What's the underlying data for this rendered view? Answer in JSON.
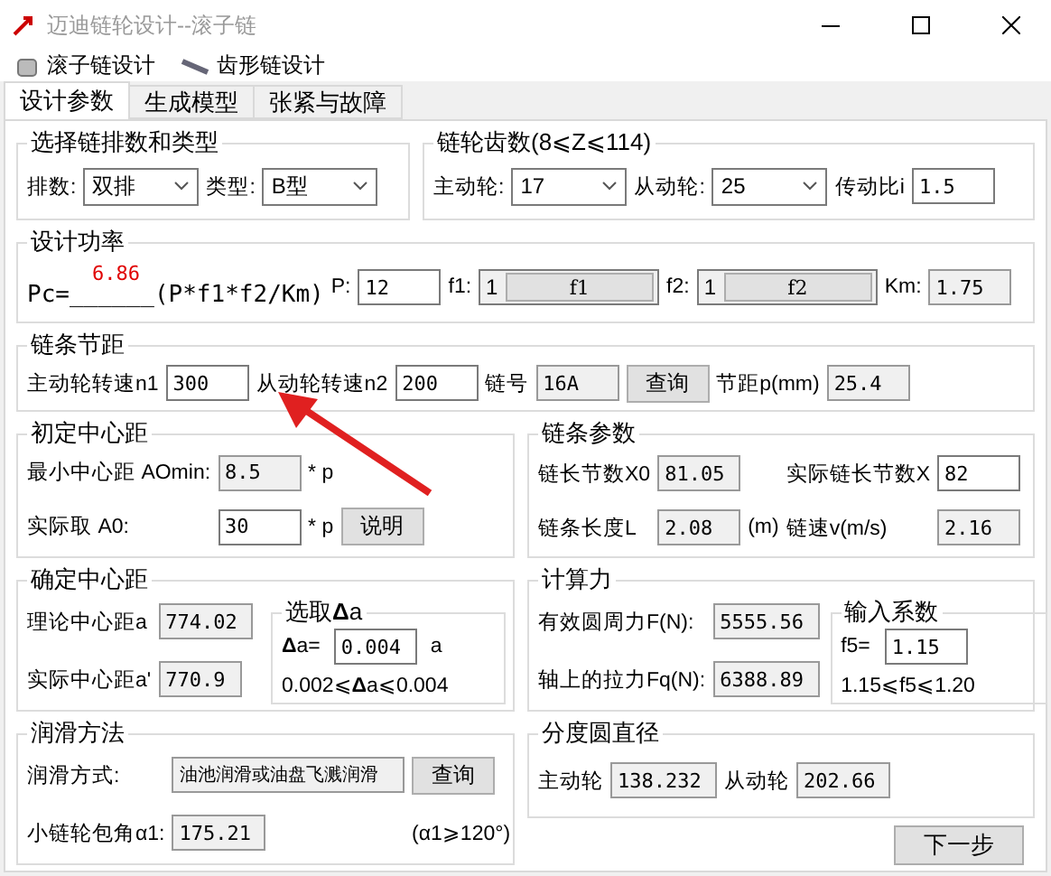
{
  "window": {
    "title": "迈迪链轮设计--滚子链"
  },
  "menu": [
    {
      "label": "滚子链设计"
    },
    {
      "label": "齿形链设计"
    }
  ],
  "tabs": [
    {
      "label": "设计参数",
      "selected": true
    },
    {
      "label": "生成模型",
      "selected": false
    },
    {
      "label": "张紧与故障",
      "selected": false
    }
  ],
  "groups": [
    {
      "title": "选择链排数和类型",
      "rows": [
        [
          {
            "kind": "label",
            "text": "排数:"
          },
          {
            "kind": "select",
            "value": "双排"
          },
          {
            "kind": "label",
            "text": "类型:"
          },
          {
            "kind": "select",
            "value": "B型"
          }
        ]
      ]
    },
    {
      "title": "链轮齿数(8⩽Z⩽114)",
      "rows": [
        [
          {
            "kind": "label",
            "text": "主动轮:"
          },
          {
            "kind": "select",
            "value": "17"
          },
          {
            "kind": "label",
            "text": "从动轮:"
          },
          {
            "kind": "select",
            "value": "25"
          },
          {
            "kind": "label",
            "text": "传动比i"
          },
          {
            "kind": "input",
            "value": "1.5"
          }
        ]
      ]
    },
    {
      "title": "设计功率",
      "rows": [
        [
          {
            "kind": "formula",
            "prefix": "Pc=",
            "result": "6.86",
            "blank": "______",
            "suffix": "(P*f1*f2/Km)"
          },
          {
            "kind": "label",
            "text": "P:"
          },
          {
            "kind": "input",
            "value": "12"
          },
          {
            "kind": "label",
            "text": "f1:"
          },
          {
            "kind": "factor",
            "value": "1",
            "button": "f1"
          },
          {
            "kind": "label",
            "text": "f2:"
          },
          {
            "kind": "factor",
            "value": "1",
            "button": "f2"
          },
          {
            "kind": "label",
            "text": "Km:"
          },
          {
            "kind": "readonly",
            "value": "1.75"
          }
        ]
      ]
    },
    {
      "title": "链条节距",
      "rows": [
        [
          {
            "kind": "label",
            "text": "主动轮转速n1"
          },
          {
            "kind": "input",
            "value": "300"
          },
          {
            "kind": "label",
            "text": "从动轮转速n2"
          },
          {
            "kind": "input",
            "value": "200"
          },
          {
            "kind": "label",
            "text": "链号"
          },
          {
            "kind": "readonly",
            "value": "16A"
          },
          {
            "kind": "button",
            "text": "查询"
          },
          {
            "kind": "label",
            "text": "节距p(mm)"
          },
          {
            "kind": "readonly",
            "value": "25.4"
          }
        ]
      ]
    },
    {
      "title": "初定中心距",
      "rows": [
        [
          {
            "kind": "label",
            "text": "最小中心距 AOmin:"
          },
          {
            "kind": "readonly",
            "value": "8.5"
          },
          {
            "kind": "label",
            "text": "* p"
          }
        ],
        [
          {
            "kind": "label",
            "text": "实际取 A0:"
          },
          {
            "kind": "input",
            "value": "30"
          },
          {
            "kind": "label",
            "text": "* p"
          },
          {
            "kind": "button",
            "text": "说明"
          }
        ]
      ]
    },
    {
      "title": "链条参数",
      "rows": [
        [
          {
            "kind": "label",
            "text": "链长节数X0"
          },
          {
            "kind": "readonly",
            "value": "81.05"
          },
          {
            "kind": "gap"
          },
          {
            "kind": "label",
            "text": "实际链长节数X"
          },
          {
            "kind": "input",
            "value": "82"
          }
        ],
        [
          {
            "kind": "label",
            "text": "链条长度L"
          },
          {
            "kind": "readonly",
            "value": "2.08"
          },
          {
            "kind": "label",
            "text": "(m)"
          },
          {
            "kind": "label",
            "text": "链速v(m/s)"
          },
          {
            "kind": "readonly",
            "value": "2.16"
          }
        ]
      ]
    },
    {
      "title": "确定中心距",
      "rows": [
        [
          {
            "kind": "label",
            "text": "理论中心距a"
          },
          {
            "kind": "readonly",
            "value": "774.02"
          }
        ],
        [
          {
            "kind": "label",
            "text": "实际中心距a'"
          },
          {
            "kind": "readonly",
            "value": "770.9"
          }
        ]
      ],
      "inner": {
        "title": "选取**Δ**a",
        "rows": [
          [
            {
              "kind": "label",
              "text": "**Δ**a="
            },
            {
              "kind": "input",
              "value": "0.004"
            },
            {
              "kind": "label",
              "text": "a"
            }
          ],
          [
            {
              "kind": "label",
              "text": "0.002⩽**Δ**a⩽0.004"
            }
          ]
        ]
      }
    },
    {
      "title": "计算力",
      "rows": [
        [
          {
            "kind": "label",
            "text": "有效圆周力F(N):"
          },
          {
            "kind": "readonly",
            "value": "5555.56"
          }
        ],
        [
          {
            "kind": "label",
            "text": "轴上的拉力Fq(N):"
          },
          {
            "kind": "readonly",
            "value": "6388.89"
          }
        ]
      ],
      "inner": {
        "title": "输入系数",
        "rows": [
          [
            {
              "kind": "label",
              "text": "f5="
            },
            {
              "kind": "input",
              "value": "1.15"
            }
          ],
          [
            {
              "kind": "label",
              "text": "1.15⩽f5⩽1.20"
            }
          ]
        ]
      }
    },
    {
      "title": "润滑方法",
      "rows": [
        [
          {
            "kind": "label",
            "text": "润滑方式:"
          },
          {
            "kind": "readonly",
            "value": "油池润滑或油盘飞溅润滑"
          },
          {
            "kind": "button",
            "text": "查询"
          }
        ],
        [
          {
            "kind": "label",
            "text": "小链轮包角α1:"
          },
          {
            "kind": "readonly",
            "value": "175.21"
          },
          {
            "kind": "label",
            "text": "(α1⩾120°)"
          }
        ]
      ]
    },
    {
      "title": "分度圆直径",
      "rows": [
        [
          {
            "kind": "label",
            "text": "主动轮"
          },
          {
            "kind": "readonly",
            "value": "138.232"
          },
          {
            "kind": "label",
            "text": "从动轮"
          },
          {
            "kind": "readonly",
            "value": "202.66"
          }
        ]
      ]
    }
  ],
  "next_button": "下一步"
}
